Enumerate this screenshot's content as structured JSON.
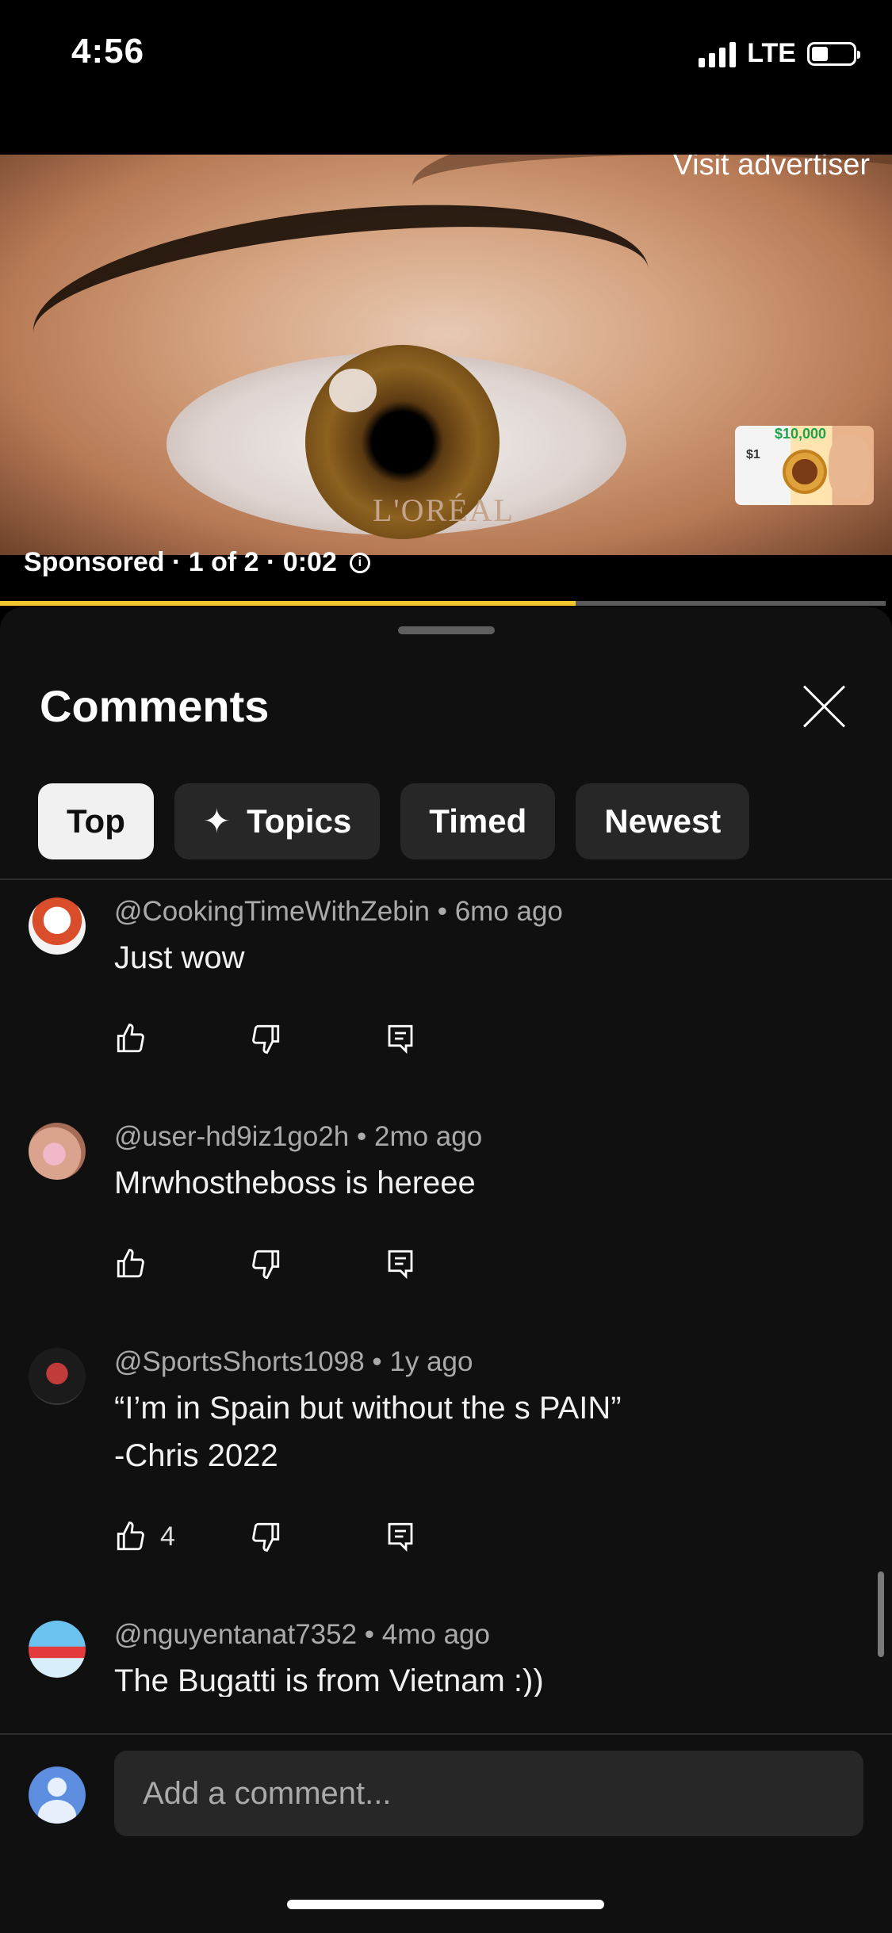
{
  "status_bar": {
    "time": "4:56",
    "network": "LTE"
  },
  "video": {
    "visit_advertiser": "Visit advertiser",
    "ad_info": "Sponsored · 1 of 2 · 0:02",
    "progress": 0.65,
    "thumb_price_big": "$10,000",
    "thumb_price_small": "$1"
  },
  "sheet": {
    "title": "Comments",
    "chips": [
      {
        "label": "Top",
        "active": true
      },
      {
        "label": "Topics",
        "icon": "sparkle-icon"
      },
      {
        "label": "Timed"
      },
      {
        "label": "Newest"
      }
    ]
  },
  "comments": [
    {
      "author": "@CookingTimeWithZebin",
      "age": "6mo ago",
      "text": "Just wow",
      "likes": ""
    },
    {
      "author": "@user-hd9iz1go2h",
      "age": "2mo ago",
      "text": "Mrwhostheboss is hereee",
      "likes": ""
    },
    {
      "author": "@SportsShorts1098",
      "age": "1y ago",
      "text": "“I’m in Spain but without the s PAIN”\n-Chris 2022",
      "likes": "4"
    },
    {
      "author": "@nguyentanat7352",
      "age": "4mo ago",
      "text": "The Bugatti is from Vietnam :))",
      "likes": ""
    }
  ],
  "composer": {
    "placeholder": "Add a comment..."
  },
  "colors": {
    "accent_progress": "#f2c531",
    "sheet_bg": "#101010",
    "chip_bg": "#272727"
  }
}
